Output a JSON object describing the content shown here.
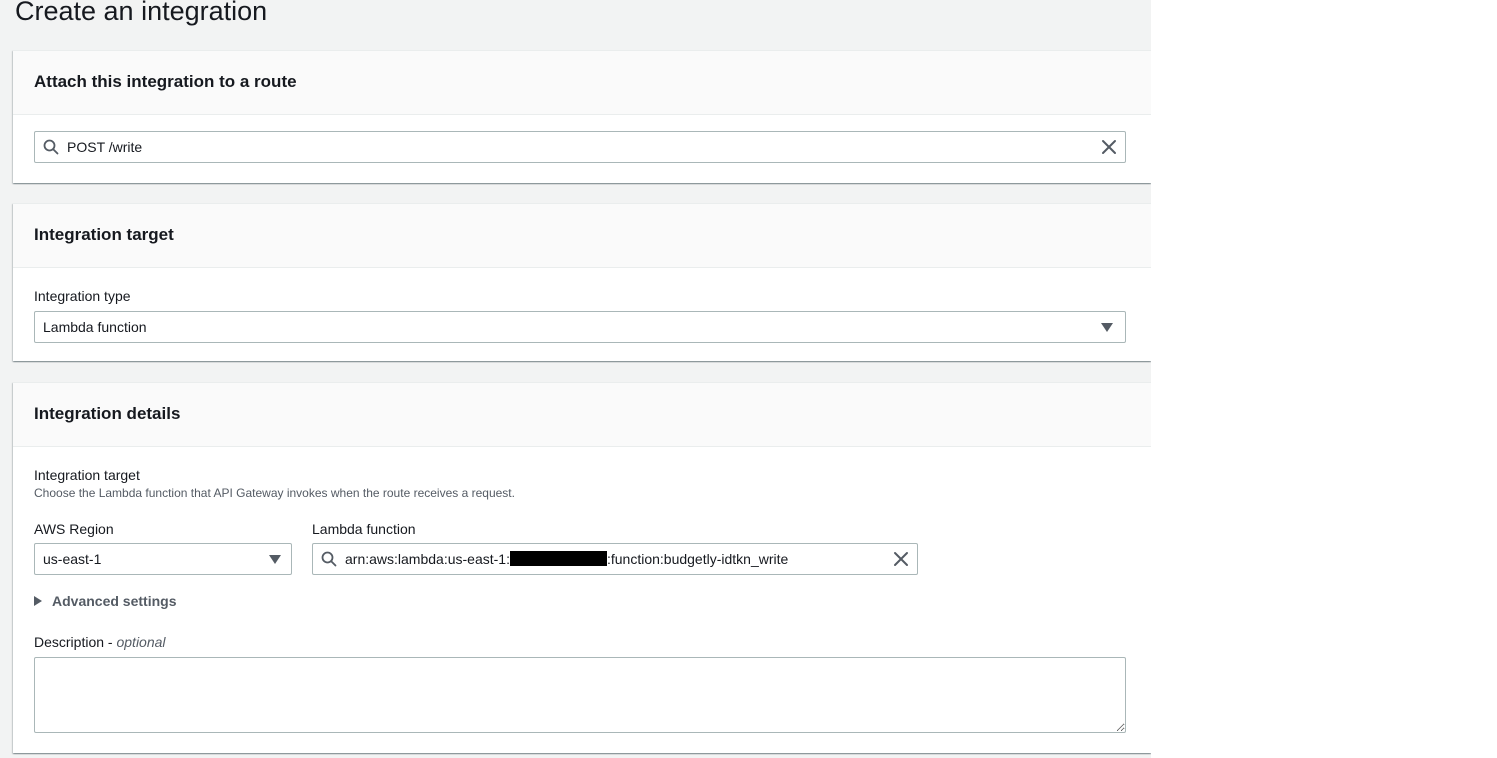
{
  "page": {
    "title": "Create an integration"
  },
  "route_section": {
    "header": "Attach this integration to a route",
    "route_value": "POST /write"
  },
  "target_section": {
    "header": "Integration target",
    "type_label": "Integration type",
    "type_value": "Lambda function"
  },
  "details_section": {
    "header": "Integration details",
    "target_label": "Integration target",
    "target_hint": "Choose the Lambda function that API Gateway invokes when the route receives a request.",
    "region_label": "AWS Region",
    "region_value": "us-east-1",
    "lambda_label": "Lambda function",
    "lambda_prefix": "arn:aws:lambda:us-east-1:",
    "lambda_suffix": ":function:budgetly-idtkn_write",
    "advanced_label": "Advanced settings",
    "description_label": "Description",
    "description_optional": "optional",
    "description_separator": " - ",
    "description_value": ""
  },
  "icons": {
    "search": "search-icon",
    "clear": "close-icon",
    "dropdown": "caret-down-icon",
    "expand": "caret-right-icon"
  },
  "colors": {
    "page_bg": "#f2f3f3",
    "text": "#16191f",
    "secondary_text": "#545b64",
    "border": "#aab7b8"
  }
}
